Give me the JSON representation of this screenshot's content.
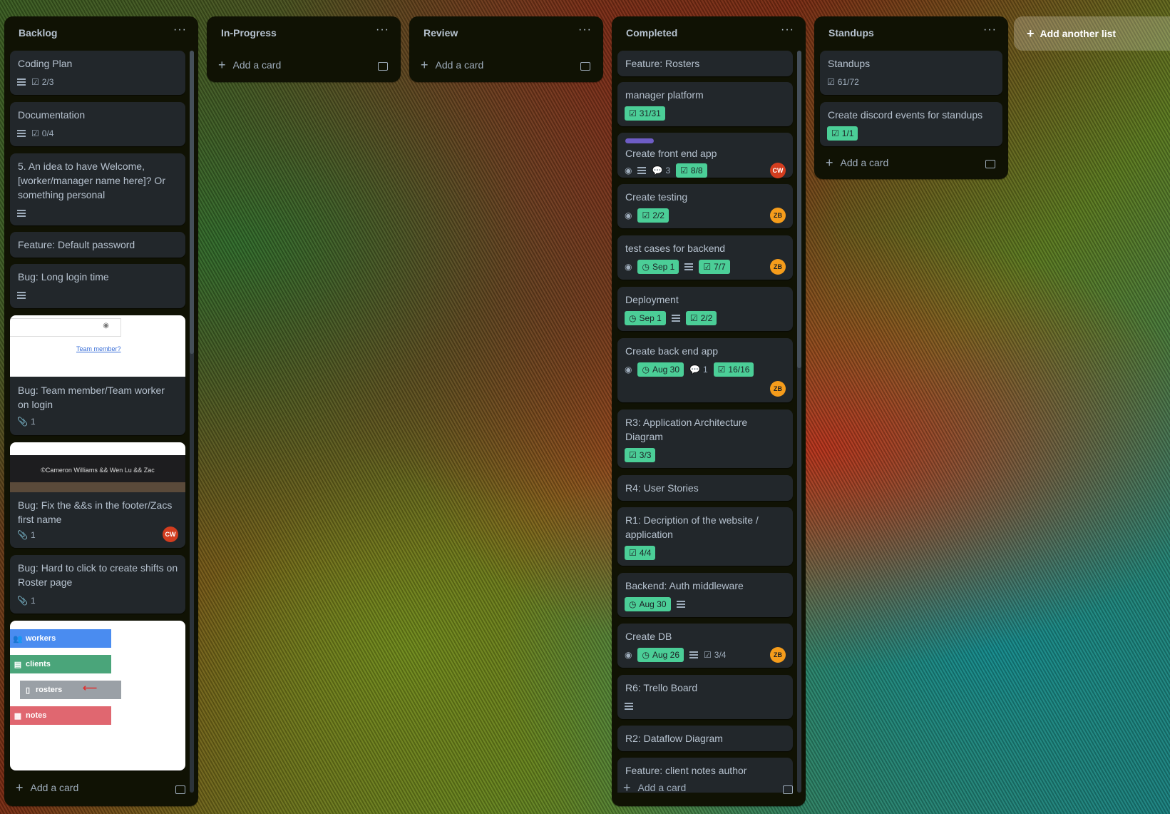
{
  "lists": {
    "backlog": {
      "title": "Backlog",
      "menu": "···",
      "add_card": "Add a card",
      "cards": [
        {
          "title": "Coding Plan",
          "checklist": "2/3"
        },
        {
          "title": "Documentation",
          "checklist": "0/4"
        },
        {
          "title": "5. An idea to have Welcome, [worker/manager name here]? Or something personal"
        },
        {
          "title": "Feature: Default password"
        },
        {
          "title": "Bug: Long login time"
        },
        {
          "title": "Bug: Team member/Team worker on login",
          "attachments": "1",
          "cover_link": "Team member?"
        },
        {
          "title": "Bug: Fix the &&s in the footer/Zacs first name",
          "attachments": "1",
          "avatar": "CW",
          "cover_text": "©Cameron Williams && Wen Lu && Zac"
        },
        {
          "title": "Bug: Hard to click to create shifts on Roster page",
          "attachments": "1"
        },
        {
          "cover_items": [
            "workers",
            "clients",
            "rosters",
            "notes"
          ]
        }
      ]
    },
    "in_progress": {
      "title": "In-Progress",
      "menu": "···",
      "add_card": "Add a card"
    },
    "review": {
      "title": "Review",
      "menu": "···",
      "add_card": "Add a card"
    },
    "completed": {
      "title": "Completed",
      "menu": "···",
      "add_card": "Add a card",
      "cards": [
        {
          "title": "Feature: Rosters"
        },
        {
          "title": "manager platform",
          "checklist": "31/31"
        },
        {
          "title": "Create front end app",
          "comments": "3",
          "checklist": "8/8",
          "avatar": "CW"
        },
        {
          "title": "Create testing",
          "checklist": "2/2",
          "avatar": "ZB"
        },
        {
          "title": "test cases for backend",
          "due": "Sep 1",
          "checklist": "7/7",
          "avatar": "ZB"
        },
        {
          "title": "Deployment",
          "due": "Sep 1",
          "checklist": "2/2"
        },
        {
          "title": "Create back end app",
          "due": "Aug 30",
          "comments": "1",
          "checklist": "16/16",
          "avatar": "ZB"
        },
        {
          "title": "R3: Application Architecture Diagram",
          "checklist": "3/3"
        },
        {
          "title": "R4: User Stories"
        },
        {
          "title": "R1: Decription of the website / application",
          "checklist": "4/4"
        },
        {
          "title": "Backend: Auth middleware",
          "due": "Aug 30"
        },
        {
          "title": "Create DB",
          "due": "Aug 26",
          "checklist": "3/4",
          "avatar": "ZB"
        },
        {
          "title": "R6: Trello Board"
        },
        {
          "title": "R2: Dataflow Diagram"
        },
        {
          "title": "Feature: client notes author"
        }
      ]
    },
    "standups": {
      "title": "Standups",
      "menu": "···",
      "add_card": "Add a card",
      "cards": [
        {
          "title": "Standups",
          "checklist": "61/72"
        },
        {
          "title": "Create discord events for standups",
          "checklist": "1/1"
        }
      ]
    }
  },
  "add_list": "Add another list",
  "colors": {
    "list_bg": "#101204",
    "card_bg": "#22272b",
    "green_badge": "#4bce97",
    "label_purple": "#6e5dc6"
  }
}
